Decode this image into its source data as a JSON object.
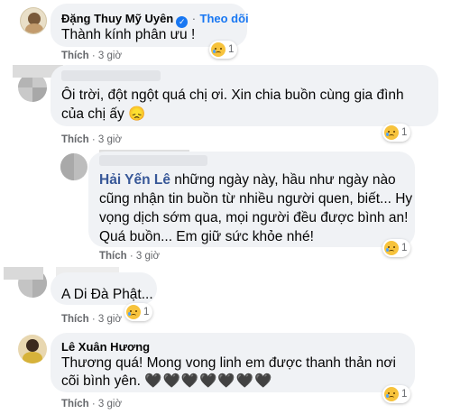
{
  "comments": [
    {
      "author": "Đặng Thuy Mỹ Uyên",
      "verified_icon": "✓",
      "follow_label": "Theo dõi",
      "text": "Thành kính phân ưu !",
      "like_label": "Thích",
      "time": "3 giờ",
      "reaction_count": "1"
    },
    {
      "text_line1": "Ôi trời, đột ngột quá chị ơi. Xin chia buồn cùng gia đình",
      "text_line2": "của chị ấy 😞",
      "like_label": "Thích",
      "time": "3 giờ",
      "reaction_count": "1"
    },
    {
      "mention": "Hải Yến Lê",
      "text_line1": " những ngày này, hầu như ngày nào",
      "text_line2": "cũng nhận tin buồn từ nhiều người quen, biết... Hy",
      "text_line3": "vọng dịch sớm qua, mọi người đều được bình an!",
      "text_line4": "Quá buồn... Em giữ sức khỏe nhé!",
      "like_label": "Thích",
      "time": "3 giờ",
      "reaction_count": "1"
    },
    {
      "text": "A Di Đà Phật...",
      "like_label": "Thích",
      "time": "3 giờ",
      "reaction_count": "1"
    },
    {
      "author": "Lê Xuân Hương",
      "text_line1": "Thương quá! Mong vong linh em được thanh thản nơi",
      "text_line2": "cõi bình yên.",
      "hearts": "🖤🖤🖤🖤🖤🖤🖤",
      "like_label": "Thích",
      "time": "3 giờ",
      "reaction_count": "1"
    }
  ],
  "separator": "·",
  "colors": {
    "bubble": "#f0f2f5",
    "accent": "#1877f2",
    "meta": "#65676b"
  }
}
